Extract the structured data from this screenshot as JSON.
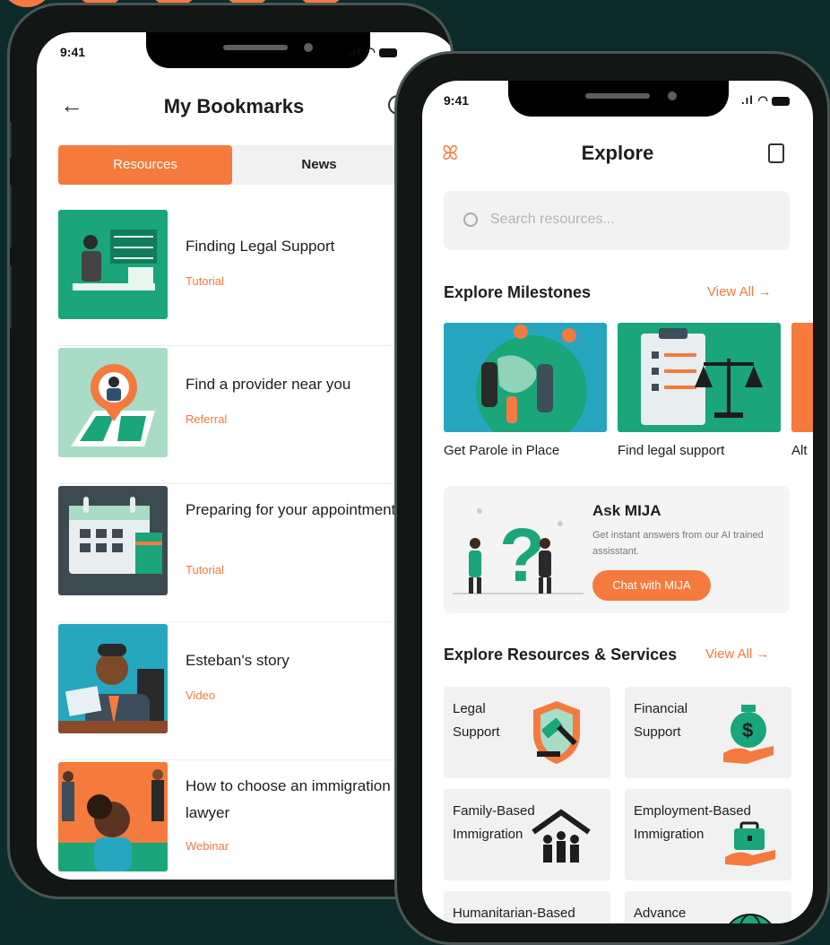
{
  "status": {
    "time": "9:41",
    "signal": ".ıl",
    "wifi": "ᯤ"
  },
  "bookmarks": {
    "title": "My Bookmarks",
    "tabs": {
      "resources": "Resources",
      "news": "News"
    },
    "items": [
      {
        "title": "Finding Legal Support",
        "type": "Tutorial"
      },
      {
        "title": "Find a provider near you",
        "type": "Referral"
      },
      {
        "title": "Preparing for your appointment",
        "type": "Tutorial"
      },
      {
        "title": "Esteban's story",
        "type": "Video"
      },
      {
        "title": "How to choose an immigration lawyer",
        "type": "Webinar"
      }
    ]
  },
  "explore": {
    "title": "Explore",
    "search_placeholder": "Search resources...",
    "milestones_title": "Explore Milestones",
    "view_all": "View All",
    "milestones": [
      {
        "label": "Get Parole in Place"
      },
      {
        "label": "Find legal support"
      },
      {
        "label": "Alt"
      }
    ],
    "ask": {
      "title": "Ask MIJA",
      "description": "Get instant answers from our AI trained assisstant.",
      "button": "Chat with MIJA"
    },
    "services_title": "Explore Resources & Services",
    "services": [
      {
        "label": "Legal Support"
      },
      {
        "label": "Financial Support"
      },
      {
        "label": "Family-Based Immigration"
      },
      {
        "label": "Employment-Based Immigration"
      },
      {
        "label": "Humanitarian-Based"
      },
      {
        "label": "Advance"
      }
    ]
  },
  "colors": {
    "accent": "#f47a3d",
    "teal": "#1aa57a",
    "background": "#0e2b2b"
  }
}
